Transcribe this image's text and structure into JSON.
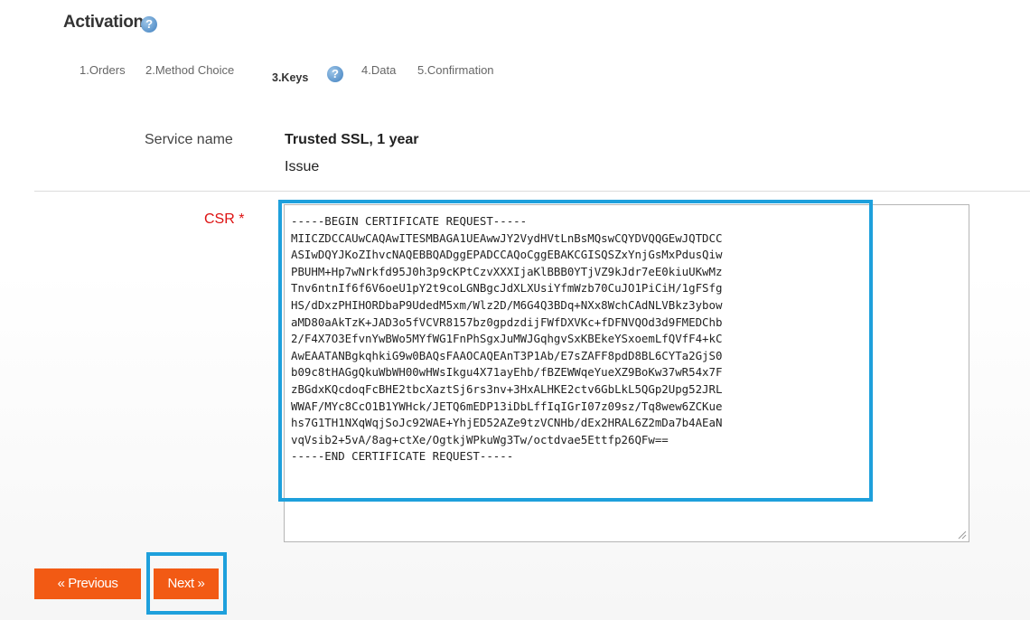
{
  "header": {
    "title": "Activation",
    "help_icon": "help-icon"
  },
  "steps": [
    {
      "label": "1.Orders",
      "active": false
    },
    {
      "label": "2.Method Choice",
      "active": false
    },
    {
      "label": "3.Keys",
      "active": true
    },
    {
      "label": "4.Data",
      "active": false
    },
    {
      "label": "5.Confirmation",
      "active": false
    }
  ],
  "service": {
    "label": "Service name",
    "name": "Trusted SSL, 1 year",
    "action": "Issue"
  },
  "csr": {
    "label": "CSR *",
    "value": "-----BEGIN CERTIFICATE REQUEST-----\nMIICZDCCAUwCAQAwITESMBAGA1UEAwwJY2VydHVtLnBsMQswCQYDVQQGEwJQTDCC\nASIwDQYJKoZIhvcNAQEBBQADggEPADCCAQoCggEBAKCGISQSZxYnjGsMxPdusQiw\nPBUHM+Hp7wNrkfd95J0h3p9cKPtCzvXXXIjaKlBBB0YTjVZ9kJdr7eE0kiuUKwMz\nTnv6ntnIf6f6V6oeU1pY2t9coLGNBgcJdXLXUsiYfmWzb70CuJO1PiCiH/1gFSfg\nHS/dDxzPHIHORDbaP9UdedM5xm/Wlz2D/M6G4Q3BDq+NXx8WchCAdNLVBkz3ybow\naMD80aAkTzK+JAD3o5fVCVR8157bz0gpdzdijFWfDXVKc+fDFNVQOd3d9FMEDChb\n2/F4X7O3EfvnYwBWo5MYfWG1FnPhSgxJuMWJGqhgvSxKBEkeYSxoemLfQVfF4+kC\nAwEAATANBgkqhkiG9w0BAQsFAAOCAQEAnT3P1Ab/E7sZAFF8pdD8BL6CYTa2GjS0\nb09c8tHAGgQkuWbWH00wHWsIkgu4X71ayEhb/fBZEWWqeYueXZ9BoKw37wR54x7F\nzBGdxKQcdoqFcBHE2tbcXaztSj6rs3nv+3HxALHKE2ctv6GbLkL5QGp2Upg52JRL\nWWAF/MYc8CcO1B1YWHck/JETQ6mEDP13iDbLffIqIGrI07z09sz/Tq8wew6ZCKue\nhs7G1TH1NXqWqjSoJc92WAE+YhjED52AZe9tzVCNHb/dEx2HRAL6Z2mDa7b4AEaN\nvqVsib2+5vA/8ag+ctXe/OgtkjWPkuWg3Tw/octdvae5Ettfp26QFw==\n-----END CERTIFICATE REQUEST-----"
  },
  "buttons": {
    "previous": "« Previous",
    "next": "Next »"
  },
  "colors": {
    "button": "#f25a14",
    "highlight": "#1ea0dc",
    "required": "#dd1111"
  }
}
